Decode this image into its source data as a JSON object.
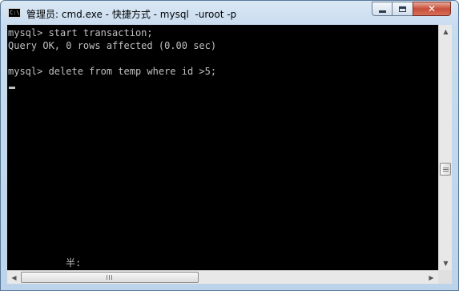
{
  "window": {
    "title": "管理员: cmd.exe - 快捷方式 - mysql  -uroot -p",
    "icon": "cmd-console-icon",
    "icon_text": "C:\\",
    "controls": {
      "minimize": "minimize-icon",
      "maximize": "maximize-icon",
      "close": "close-icon",
      "close_glyph": "✕"
    }
  },
  "console": {
    "lines": [
      "mysql> start transaction;",
      "Query OK, 0 rows affected (0.00 sec)",
      "",
      "mysql> delete from temp where id >5;"
    ],
    "ime_indicator": "半:",
    "background_color": "#000000",
    "text_color": "#c0c0c0"
  },
  "scrollbars": {
    "up_glyph": "▲",
    "down_glyph": "▼",
    "left_glyph": "◀",
    "right_glyph": "▶"
  }
}
